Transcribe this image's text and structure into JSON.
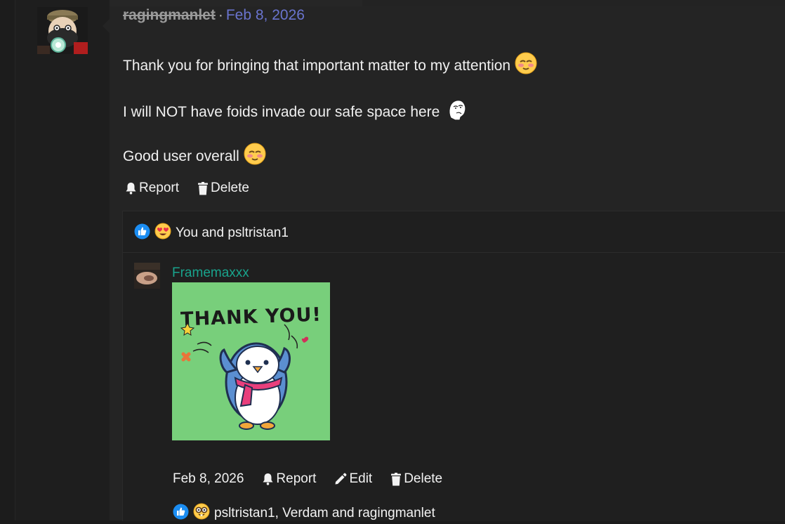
{
  "post": {
    "username": "ragingmanlet",
    "separator": "·",
    "date": "Feb 8, 2026",
    "lines": [
      {
        "text": "Thank you for bringing that important matter to my attention",
        "emoji": "blushing-face"
      },
      {
        "text": "I will NOT have foids invade our safe space here",
        "emoji": "wojak-face"
      },
      {
        "text": "Good user overall",
        "emoji": "blushing-face"
      }
    ],
    "actions": {
      "report": "Report",
      "delete": "Delete"
    }
  },
  "reactions": {
    "icons": [
      "thumbs-up-icon",
      "heart-eyes-icon"
    ],
    "text": "You and psltristan1"
  },
  "reply": {
    "username": "Framemaxxx",
    "gif_text": "THANK YOU!",
    "date": "Feb 8, 2026",
    "actions": {
      "report": "Report",
      "edit": "Edit",
      "delete": "Delete"
    },
    "reactions": {
      "icons": [
        "thumbs-up-icon",
        "nerd-face-icon"
      ],
      "text": "psltristan1, Verdam and ragingmanlet"
    }
  },
  "colors": {
    "background": "#1b1b1b",
    "main_panel": "#242424",
    "date_link": "#6a74cf",
    "reply_username": "#19a38c",
    "gif_background": "#78cf7b"
  }
}
